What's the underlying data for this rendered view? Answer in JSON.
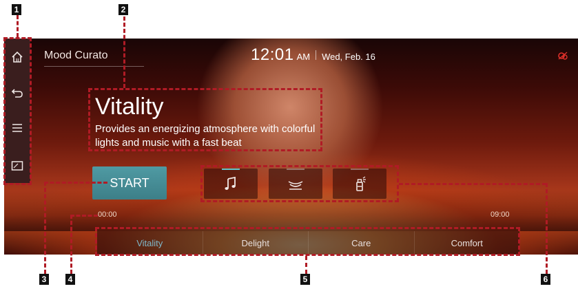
{
  "header": {
    "title": "Mood Curato",
    "time": "12:01",
    "ampm": "AM",
    "date": "Wed, Feb. 16"
  },
  "sidebar": {
    "items": [
      {
        "icon": "home-icon"
      },
      {
        "icon": "back-arrow-icon"
      },
      {
        "icon": "menu-icon"
      },
      {
        "icon": "split-screen-icon"
      }
    ]
  },
  "mood": {
    "name": "Vitality",
    "description": "Provides an energizing atmosphere with colorful lights and music with a fast beat"
  },
  "controls": {
    "start_label": "START",
    "features": [
      {
        "icon": "music-note-icon",
        "active": true
      },
      {
        "icon": "ambient-light-icon",
        "active": false
      },
      {
        "icon": "fragrance-icon",
        "active": false
      }
    ]
  },
  "timer": {
    "start": "00:00",
    "end": "09:00"
  },
  "tabs": [
    {
      "label": "Vitality",
      "active": true
    },
    {
      "label": "Delight",
      "active": false
    },
    {
      "label": "Care",
      "active": false
    },
    {
      "label": "Comfort",
      "active": false
    }
  ],
  "callouts": [
    "1",
    "2",
    "3",
    "4",
    "5",
    "6"
  ],
  "colors": {
    "accent": "#61c3c9",
    "callout": "#b01b25",
    "start_button": "#4f9aa3"
  }
}
